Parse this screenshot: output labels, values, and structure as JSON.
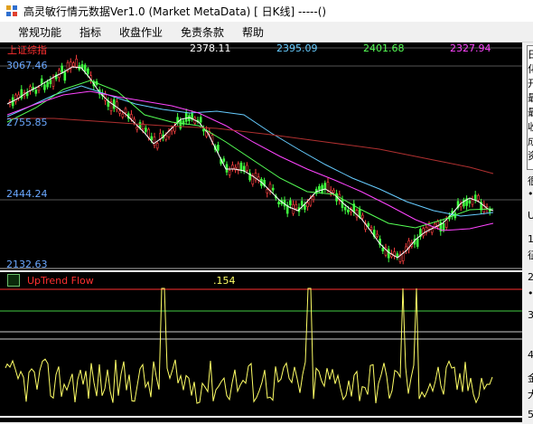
{
  "window": {
    "title": "高灵敏行情元数据Ver1.0 (Market MetaData)   [ 日K线] -----()"
  },
  "menu": [
    "常规功能",
    "指标",
    "收盘作业",
    "免责条款",
    "帮助"
  ],
  "main_panel": {
    "index_name": "上证综指",
    "ma_values": [
      "2378.11",
      "2395.09",
      "2401.68",
      "2327.94"
    ],
    "price_axis": [
      "3067.46",
      "2755.85",
      "2444.24",
      "2132.63"
    ]
  },
  "indicator_panel": {
    "name": "UpTrend Flow",
    "value": ".154"
  },
  "right_panel": {
    "chars": [
      "日",
      "化",
      "开",
      "最",
      "最",
      "收",
      "成",
      "资",
      "很",
      "•",
      "U",
      "1",
      "征",
      "2",
      "•",
      "3",
      "4",
      "金",
      "大",
      "5"
    ]
  },
  "colors": {
    "background": "#000000",
    "index_name": "#ff3030",
    "ma1": "#ffffff",
    "ma2": "#66ccff",
    "ma3": "#55ff55",
    "ma4": "#ff44ff",
    "price_axis": "#6aa8ff",
    "indicator_name": "#ff3030",
    "indicator_value": "#ffff66",
    "flow_line": "#ffff66"
  }
}
